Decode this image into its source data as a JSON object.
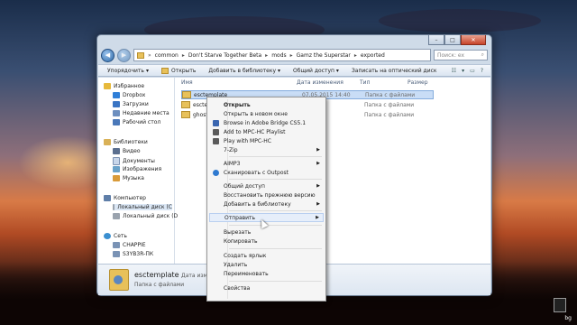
{
  "explorer": {
    "address": [
      "common",
      "Don't Starve Together Beta",
      "mods",
      "Gamz the Superstar",
      "exported"
    ],
    "search_placeholder": "Поиск: ex",
    "toolbar": [
      "Упорядочить",
      "Открыть",
      "Добавить в библиотеку",
      "Общий доступ",
      "Записать на оптический диск"
    ],
    "columns": {
      "name": "Имя",
      "date": "Дата изменения",
      "type": "Тип",
      "size": "Размер"
    },
    "sidebar": {
      "favorites": "Избранное",
      "fav_items": [
        "Dropbox",
        "Загрузки",
        "Недавние места",
        "Рабочий стол"
      ],
      "libraries": "Библиотеки",
      "lib_items": [
        "Видео",
        "Документы",
        "Изображения",
        "Музыка"
      ],
      "computer": "Компьютер",
      "pc_items": [
        "Локальный диск (C",
        "Локальный диск (D"
      ],
      "network": "Сеть",
      "net_items": [
        "CHAPPIE",
        "S3YB3R-ПК"
      ]
    },
    "files": [
      {
        "name": "esctemplate",
        "date": "07.05.2015 14:40",
        "type": "Папка с файлами"
      },
      {
        "name": "esctem",
        "date": "40",
        "type": "Папка с файлами"
      },
      {
        "name": "ghost_e",
        "date": "40",
        "type": "Папка с файлами"
      }
    ],
    "status": {
      "name": "esctemplate",
      "date_label": "Дата изм",
      "kind": "Папка с файлами"
    }
  },
  "context_menu": [
    "Открыть",
    "Открыть в новом окне",
    "Browse in Adobe Bridge CS5.1",
    "Add to MPC-HC Playlist",
    "Play with MPC-HC",
    "7-Zip",
    "AIMP3",
    "Сканировать с Outpost",
    "Общий доступ",
    "Восстановить прежнюю версию",
    "Добавить в библиотеку",
    "Отправить",
    "Вырезать",
    "Копировать",
    "Создать ярлык",
    "Удалить",
    "Переименовать",
    "Свойства"
  ],
  "tray": {
    "label": "bg"
  },
  "icons": [
    "back-icon",
    "forward-icon",
    "folder-icon",
    "search-icon",
    "close-icon",
    "minimize-icon",
    "maximize-icon",
    "view-icon",
    "help-icon"
  ]
}
